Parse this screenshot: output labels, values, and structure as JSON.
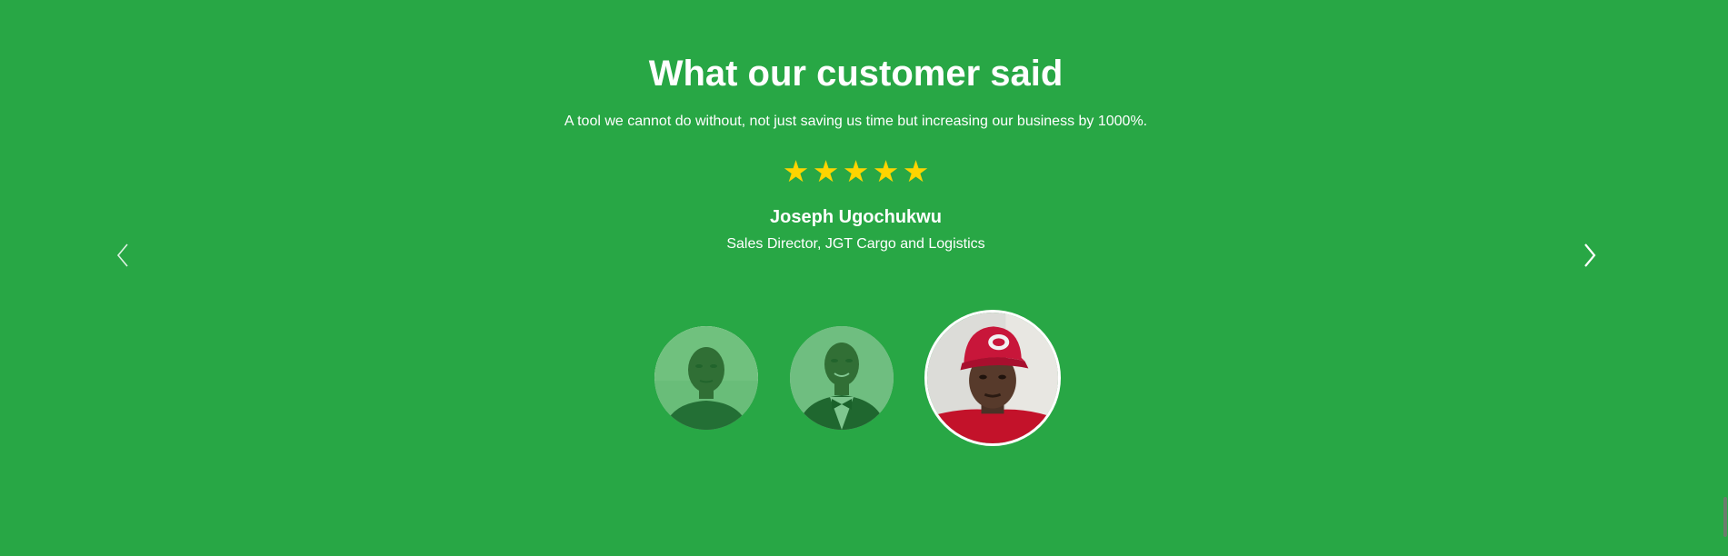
{
  "testimonials": {
    "heading": "What our customer said",
    "quote": "A tool we cannot do without, not just saving us time but increasing our business by 1000%.",
    "rating": {
      "stars": 5,
      "max": 5,
      "star_glyph": "★",
      "color": "#ffd400"
    },
    "author": {
      "name": "Joseph Ugochukwu",
      "role": "Sales Director, JGT Cargo and Logistics"
    },
    "navigation": {
      "prev_icon": "chevron-left-icon",
      "next_icon": "chevron-right-icon"
    },
    "avatars": [
      {
        "icon": "customer-avatar-1",
        "active": false
      },
      {
        "icon": "customer-avatar-2",
        "active": false
      },
      {
        "icon": "customer-avatar-3",
        "active": true
      }
    ]
  },
  "theme": {
    "background": "#28a745",
    "text": "#ffffff",
    "star": "#ffd400"
  }
}
